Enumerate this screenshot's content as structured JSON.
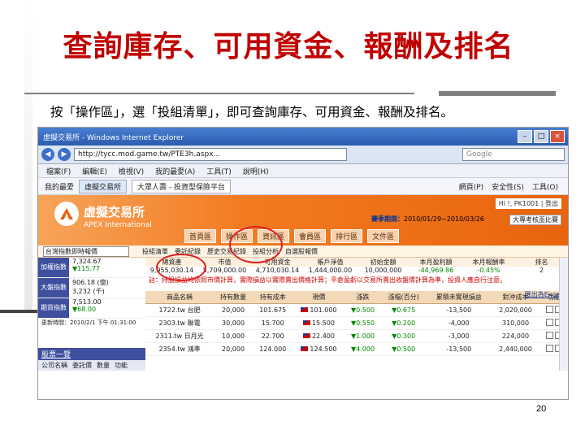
{
  "slide": {
    "title": "查詢庫存、可用資金、報酬及排名",
    "subtitle": "按「操作區」，選「投組清單」，即可查詢庫存、可用資金、報酬及排名。",
    "page_number": "20"
  },
  "browser": {
    "window_title": "虛擬交易所 - Windows Internet Explorer",
    "url": "http://tycc.mod.game.tw/PTE3h.aspx...",
    "search_placeholder": "Google",
    "menu": [
      "檔案(F)",
      "編輯(E)",
      "檢視(V)",
      "我的最愛(A)",
      "工具(T)",
      "說明(H)"
    ],
    "favorites_label": "我的最愛",
    "tabs": [
      "虛擬交易所",
      "大眾人壽 - 投資型保險平台"
    ],
    "toolbar_right": [
      "網頁(P)",
      "安全性(S)",
      "工具(O)"
    ]
  },
  "site": {
    "brand": "虛擬交易所",
    "brand_sub": "APEX International",
    "user": "Hi !, PK1001 | 登出",
    "date_range_label": "賽季期間：",
    "date_range": "2010/01/29~2010/03/26",
    "competition": "大專考核盃比賽",
    "nav_tabs": [
      "首頁區",
      "操作區",
      "資訊區",
      "會員區",
      "排行區",
      "文件區"
    ],
    "index_select": "台灣指數即時報價",
    "sub_tabs": [
      "投組清單",
      "委託紀錄",
      "歷史交易紀錄",
      "投組分析",
      "自選股報價"
    ]
  },
  "indices": [
    {
      "label": "加權指數",
      "value": "7,324.67",
      "change": "▼115.77",
      "dir": "down"
    },
    {
      "label": "大盤指數",
      "value": "906.18 (億)",
      "change": "3,232 (千)",
      "dir": "none"
    },
    {
      "label": "期貨指數",
      "value": "7,513.00",
      "change": "▼68.00",
      "dir": "down"
    }
  ],
  "update_time": "更新時間：2010/2/1 下午 01:31:00",
  "watch_section": {
    "title": "股票一覽",
    "columns": [
      "公司名稱",
      "委託價",
      "數量",
      "功能"
    ]
  },
  "summary": {
    "headers": [
      "總資產",
      "市值",
      "可用資金",
      "帳戶淨值",
      "初始金額",
      "本月盈利額",
      "本月報酬率",
      "排名"
    ],
    "values": [
      "9,955,030.14",
      "5,709,000.00",
      "4,710,030.14",
      "1,444,000.00",
      "10,000,000",
      "-44,969.86",
      "-0.45%",
      "2"
    ]
  },
  "note": "註：持股損益均依照市價計算，實際損益以實際賣出價格計算；平倉盈虧以交易所賣出收盤價計算為準，投資人應自行注意。",
  "excel_link": "匯出為Excel",
  "holdings": {
    "columns": [
      "商品名稱",
      "持有數量",
      "持有成本",
      "現價",
      "漲跌",
      "漲幅(百分)",
      "累積未實現損益",
      "對沖成本",
      "功能"
    ],
    "rows": [
      [
        "1722.tw 台肥",
        "20,000",
        "101.675",
        "101.000",
        "▼0.500",
        "▼0.675",
        "-13,500",
        "2,020,000",
        ""
      ],
      [
        "2303.tw 聯電",
        "30,000",
        "15.700",
        "15.500",
        "▼0.550",
        "▼0.200",
        "-4,000",
        "310,000",
        ""
      ],
      [
        "2311.tw 日月光",
        "10,000",
        "22.700",
        "22.400",
        "▼1.000",
        "▼0.300",
        "-3,000",
        "224,000",
        ""
      ],
      [
        "2354.tw 鴻準",
        "20,000",
        "124.000",
        "124.500",
        "▼4.000",
        "▼0.500",
        "-13,500",
        "2,440,000",
        ""
      ]
    ]
  },
  "colors": {
    "title": "#c00000",
    "banner": "#f37a20",
    "highlight_oval": "#e02020",
    "panel": "#3e4f9e"
  }
}
